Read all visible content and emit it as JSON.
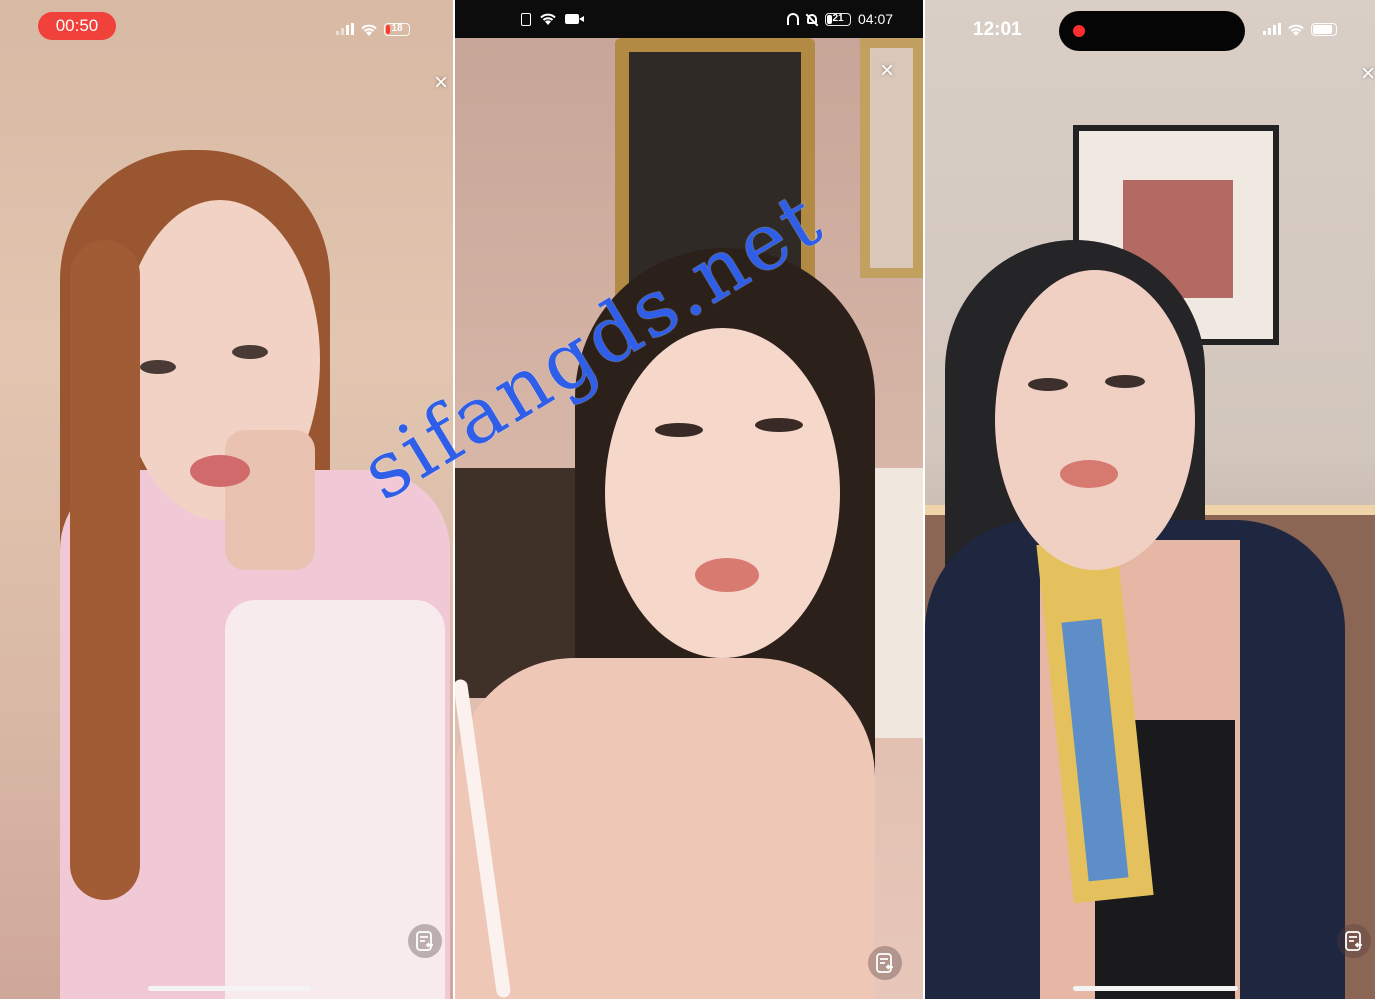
{
  "panels": [
    {
      "status": {
        "time": "00:50",
        "battery": "18"
      },
      "controls": {
        "close_label": "×"
      }
    },
    {
      "status": {
        "time": "04:07",
        "battery": "21"
      },
      "controls": {
        "close_label": "×"
      }
    },
    {
      "status": {
        "time": "12:01"
      },
      "controls": {
        "close_label": "×"
      }
    }
  ],
  "watermark": "sifangds.net",
  "colors": {
    "recording_red": "#f0413a",
    "watermark_blue": "#2f5fe8",
    "status_bar_dark": "#0c0c0c"
  },
  "icons": [
    "signal-icon",
    "wifi-icon",
    "battery-icon",
    "close-icon",
    "chat-list-icon",
    "camera-icon",
    "headphones-icon",
    "mute-icon",
    "sim-icon"
  ]
}
